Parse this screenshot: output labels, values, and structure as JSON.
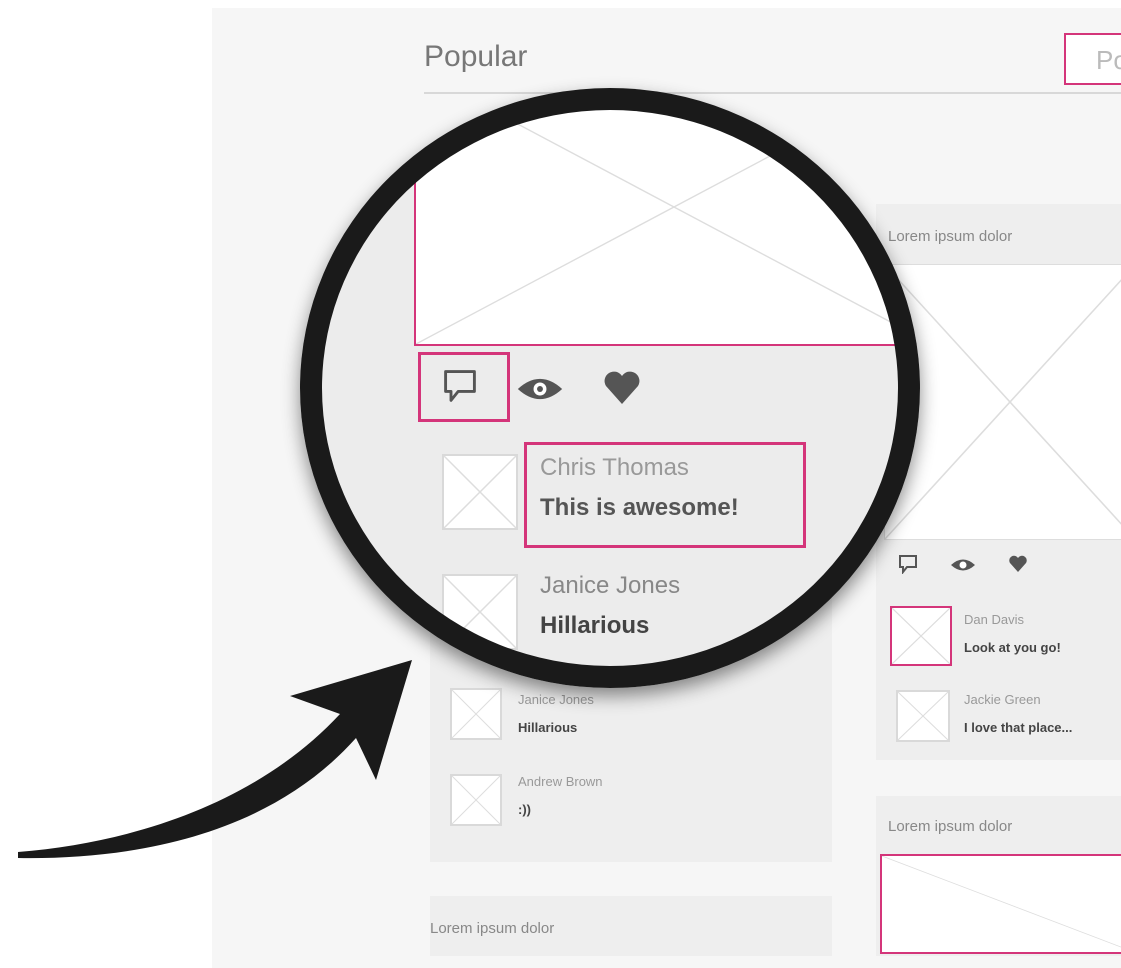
{
  "header": {
    "title": "Popular",
    "search_text": "Po"
  },
  "colors": {
    "accent": "#d4357a",
    "ring": "#1a1a1a",
    "panel": "#eeeeee"
  },
  "left_card": {
    "comments": [
      {
        "name": "Janice Jones",
        "text": "Hillarious"
      },
      {
        "name": "Andrew Brown",
        "text": ":))"
      }
    ]
  },
  "left_card_2": {
    "heading": "Lorem ipsum dolor"
  },
  "right_card": {
    "heading": "Lorem ipsum dolor",
    "icons": [
      "comment-icon",
      "eye-icon",
      "heart-icon"
    ],
    "comments": [
      {
        "name": "Dan Davis",
        "text": "Look at you go!"
      },
      {
        "name": "Jackie Green",
        "text": "I love that place..."
      }
    ]
  },
  "right_card_2": {
    "heading": "Lorem ipsum dolor"
  },
  "zoom": {
    "icons": [
      "comment-icon",
      "eye-icon",
      "heart-icon"
    ],
    "comments": [
      {
        "name": "Chris Thomas",
        "text": "This is awesome!"
      },
      {
        "name": "Janice Jones",
        "text": "Hillarious"
      }
    ]
  }
}
